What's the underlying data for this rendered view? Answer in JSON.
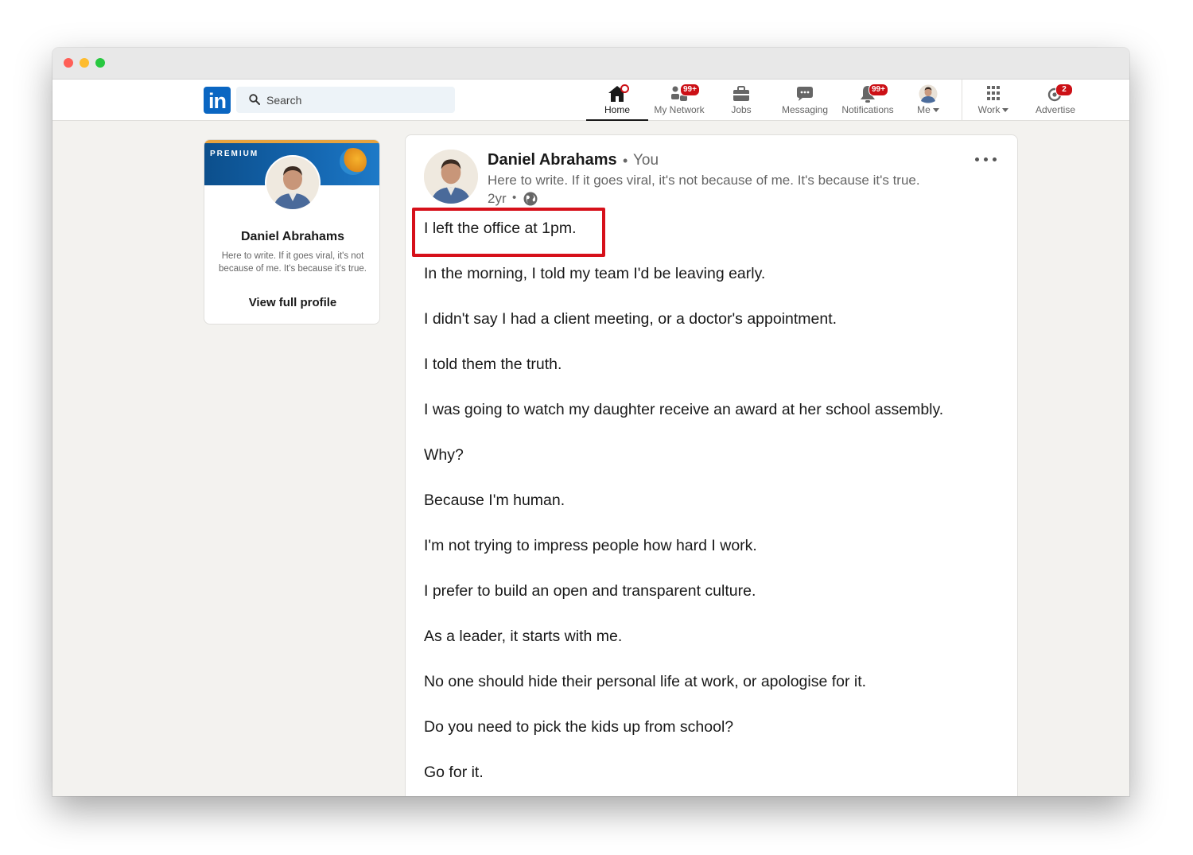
{
  "nav": {
    "search_placeholder": "Search",
    "items": [
      {
        "label": "Home",
        "icon": "home-icon",
        "active": true
      },
      {
        "label": "My Network",
        "icon": "network-icon",
        "badge": "99+"
      },
      {
        "label": "Jobs",
        "icon": "briefcase-icon"
      },
      {
        "label": "Messaging",
        "icon": "messaging-icon"
      },
      {
        "label": "Notifications",
        "icon": "bell-icon",
        "badge": "99+"
      },
      {
        "label": "Me",
        "icon": "avatar"
      },
      {
        "label": "Work",
        "icon": "grid-icon"
      },
      {
        "label": "Advertise",
        "icon": "advertise-icon",
        "badge": "2"
      }
    ]
  },
  "profile": {
    "premium_label": "PREMIUM",
    "name": "Daniel Abrahams",
    "headline": "Here to write. If it goes viral, it's not because of me. It's because it's true.",
    "link": "View full profile"
  },
  "post": {
    "author": "Daniel Abrahams",
    "separator": "•",
    "degree": "You",
    "headline": "Here to write. If it goes viral, it's not because of me. It's because it's true.",
    "time": "2yr",
    "lines": [
      "I left the office at 1pm.",
      "In the morning, I told my team I'd be leaving early.",
      "I didn't say I had a client meeting, or a doctor's appointment.",
      "I told them the truth.",
      "I was going to watch my daughter receive an award at her school assembly.",
      "Why?",
      "Because I'm human.",
      "I'm not trying to impress people how hard I work.",
      "I prefer to build an open and transparent culture.",
      "As a leader, it starts with me.",
      "No one should hide their personal life at work, or apologise for it.",
      "Do you need to pick the kids up from school?",
      "Go for it."
    ]
  },
  "colors": {
    "brand": "#0a66c2",
    "badge": "#cc1016",
    "highlight": "#d6101a"
  }
}
